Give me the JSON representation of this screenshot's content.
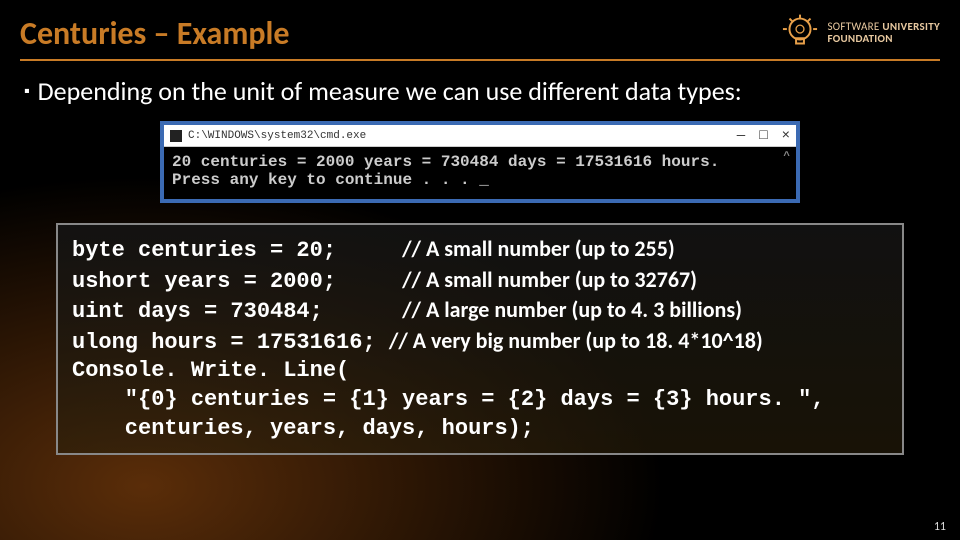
{
  "title": "Centuries – Example",
  "logo": {
    "line1": "SOFTWARE",
    "line2": "UNIVERSITY",
    "line3": "FOUNDATION"
  },
  "bullet": "Depending on the unit of measure we can use different data types:",
  "cmd": {
    "title": "C:\\WINDOWS\\system32\\cmd.exe",
    "line1": "20 centuries = 2000 years = 730484 days = 17531616 hours.",
    "line2": "Press any key to continue . . . _",
    "min": "—",
    "max": "□",
    "close": "×",
    "caret": "^"
  },
  "code": {
    "l1_left": "byte centuries = 20;",
    "l1_comment": "// A small number (up to 255)",
    "l2_left": "ushort years = 2000;",
    "l2_comment": "// A small number (up to 32767)",
    "l3_left": "uint days = 730484;",
    "l3_comment": "// A large number (up to 4. 3 billions)",
    "l4_left": "ulong hours = 17531616;",
    "l4_comment": "// A very big number (up to 18. 4*10^18)",
    "l5": "Console. Write. Line(",
    "l6": "    \"{0} centuries = {1} years = {2} days = {3} hours. \",",
    "l7": "    centuries, years, days, hours);"
  },
  "page_number": "11"
}
